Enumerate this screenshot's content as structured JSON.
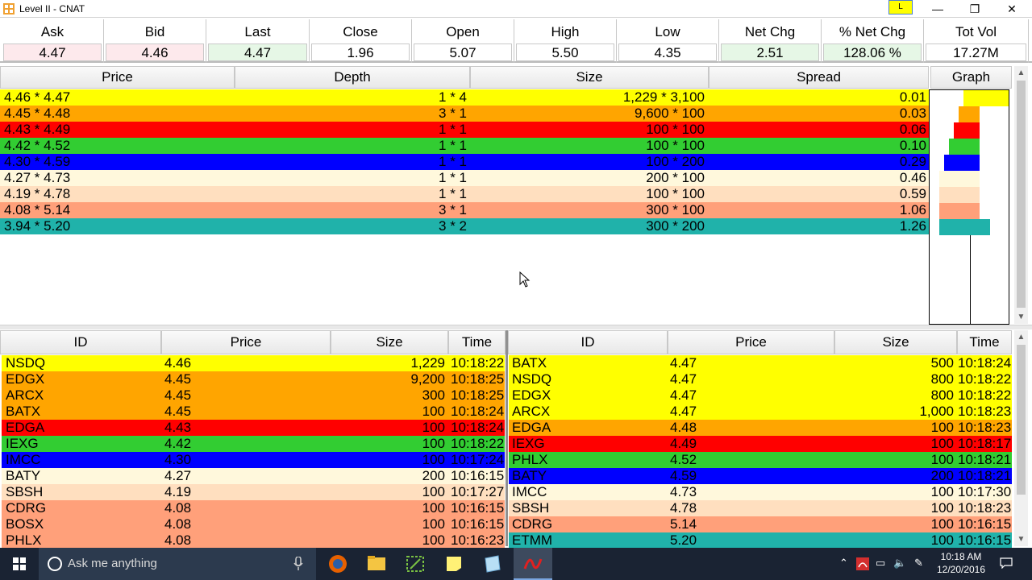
{
  "window": {
    "title": "Level II - CNAT",
    "badge": "L",
    "min": "—",
    "max": "❐",
    "close": "✕"
  },
  "quote": [
    {
      "label": "Ask",
      "value": "4.47",
      "bg": "#fde9ec"
    },
    {
      "label": "Bid",
      "value": "4.46",
      "bg": "#fde9ec"
    },
    {
      "label": "Last",
      "value": "4.47",
      "bg": "#e6f7e6"
    },
    {
      "label": "Close",
      "value": "1.96",
      "bg": "#ffffff"
    },
    {
      "label": "Open",
      "value": "5.07",
      "bg": "#ffffff"
    },
    {
      "label": "High",
      "value": "5.50",
      "bg": "#ffffff"
    },
    {
      "label": "Low",
      "value": "4.35",
      "bg": "#ffffff"
    },
    {
      "label": "Net Chg",
      "value": "2.51",
      "bg": "#e6f7e6"
    },
    {
      "label": "% Net Chg",
      "value": "128.06 %",
      "bg": "#e6f7e6"
    },
    {
      "label": "Tot Vol",
      "value": "17.27M",
      "bg": "#ffffff"
    }
  ],
  "depth": {
    "headers": {
      "price": "Price",
      "depth": "Depth",
      "size": "Size",
      "spread": "Spread",
      "graph": "Graph"
    },
    "rows": [
      {
        "price": "4.46 * 4.47",
        "depth": "1 * 4",
        "size": "1,229 * 3,100",
        "spread": "0.01",
        "bg": "#ffff00",
        "fg": "#000000"
      },
      {
        "price": "4.45 * 4.48",
        "depth": "3 * 1",
        "size": "9,600 * 100",
        "spread": "0.03",
        "bg": "#ffa500",
        "fg": "#000000"
      },
      {
        "price": "4.43 * 4.49",
        "depth": "1 * 1",
        "size": "100 * 100",
        "spread": "0.06",
        "bg": "#ff0000",
        "fg": "#000000"
      },
      {
        "price": "4.42 * 4.52",
        "depth": "1 * 1",
        "size": "100 * 100",
        "spread": "0.10",
        "bg": "#32cd32",
        "fg": "#000000"
      },
      {
        "price": "4.30 * 4.59",
        "depth": "1 * 1",
        "size": "100 * 200",
        "spread": "0.29",
        "bg": "#0000ff",
        "fg": "#000000"
      },
      {
        "price": "4.27 * 4.73",
        "depth": "1 * 1",
        "size": "200 * 100",
        "spread": "0.46",
        "bg": "#fff8dc",
        "fg": "#000000"
      },
      {
        "price": "4.19 * 4.78",
        "depth": "1 * 1",
        "size": "100 * 100",
        "spread": "0.59",
        "bg": "#ffdfbf",
        "fg": "#000000"
      },
      {
        "price": "4.08 * 5.14",
        "depth": "3 * 1",
        "size": "300 * 100",
        "spread": "1.06",
        "bg": "#ffa07a",
        "fg": "#000000"
      },
      {
        "price": "3.94 * 5.20",
        "depth": "3 * 2",
        "size": "300 * 200",
        "spread": "1.26",
        "bg": "#20b2aa",
        "fg": "#000000"
      }
    ]
  },
  "bid_book": {
    "headers": {
      "id": "ID",
      "price": "Price",
      "size": "Size",
      "time": "Time"
    },
    "rows": [
      {
        "id": "NSDQ",
        "price": "4.46",
        "size": "1,229",
        "time": "10:18:22",
        "bg": "#ffff00"
      },
      {
        "id": "EDGX",
        "price": "4.45",
        "size": "9,200",
        "time": "10:18:25",
        "bg": "#ffa500"
      },
      {
        "id": "ARCX",
        "price": "4.45",
        "size": "300",
        "time": "10:18:25",
        "bg": "#ffa500"
      },
      {
        "id": "BATX",
        "price": "4.45",
        "size": "100",
        "time": "10:18:24",
        "bg": "#ffa500"
      },
      {
        "id": "EDGA",
        "price": "4.43",
        "size": "100",
        "time": "10:18:24",
        "bg": "#ff0000"
      },
      {
        "id": "IEXG",
        "price": "4.42",
        "size": "100",
        "time": "10:18:22",
        "bg": "#32cd32"
      },
      {
        "id": "IMCC",
        "price": "4.30",
        "size": "100",
        "time": "10:17:24",
        "bg": "#0000ff"
      },
      {
        "id": "BATY",
        "price": "4.27",
        "size": "200",
        "time": "10:16:15",
        "bg": "#fff8dc"
      },
      {
        "id": "SBSH",
        "price": "4.19",
        "size": "100",
        "time": "10:17:27",
        "bg": "#ffdfbf"
      },
      {
        "id": "CDRG",
        "price": "4.08",
        "size": "100",
        "time": "10:16:15",
        "bg": "#ffa07a"
      },
      {
        "id": "BOSX",
        "price": "4.08",
        "size": "100",
        "time": "10:16:15",
        "bg": "#ffa07a"
      },
      {
        "id": "PHLX",
        "price": "4.08",
        "size": "100",
        "time": "10:16:23",
        "bg": "#ffa07a"
      }
    ]
  },
  "ask_book": {
    "headers": {
      "id": "ID",
      "price": "Price",
      "size": "Size",
      "time": "Time"
    },
    "rows": [
      {
        "id": "BATX",
        "price": "4.47",
        "size": "500",
        "time": "10:18:24",
        "bg": "#ffff00"
      },
      {
        "id": "NSDQ",
        "price": "4.47",
        "size": "800",
        "time": "10:18:22",
        "bg": "#ffff00"
      },
      {
        "id": "EDGX",
        "price": "4.47",
        "size": "800",
        "time": "10:18:22",
        "bg": "#ffff00"
      },
      {
        "id": "ARCX",
        "price": "4.47",
        "size": "1,000",
        "time": "10:18:23",
        "bg": "#ffff00"
      },
      {
        "id": "EDGA",
        "price": "4.48",
        "size": "100",
        "time": "10:18:23",
        "bg": "#ffa500"
      },
      {
        "id": "IEXG",
        "price": "4.49",
        "size": "100",
        "time": "10:18:17",
        "bg": "#ff0000"
      },
      {
        "id": "PHLX",
        "price": "4.52",
        "size": "100",
        "time": "10:18:21",
        "bg": "#32cd32"
      },
      {
        "id": "BATY",
        "price": "4.59",
        "size": "200",
        "time": "10:18:21",
        "bg": "#0000ff"
      },
      {
        "id": "IMCC",
        "price": "4.73",
        "size": "100",
        "time": "10:17:30",
        "bg": "#fff8dc"
      },
      {
        "id": "SBSH",
        "price": "4.78",
        "size": "100",
        "time": "10:18:23",
        "bg": "#ffdfbf"
      },
      {
        "id": "CDRG",
        "price": "5.14",
        "size": "100",
        "time": "10:16:15",
        "bg": "#ffa07a"
      },
      {
        "id": "ETMM",
        "price": "5.20",
        "size": "100",
        "time": "10:16:15",
        "bg": "#20b2aa"
      }
    ]
  },
  "taskbar": {
    "search_placeholder": "Ask me anything",
    "time": "10:18 AM",
    "date": "12/20/2016"
  }
}
